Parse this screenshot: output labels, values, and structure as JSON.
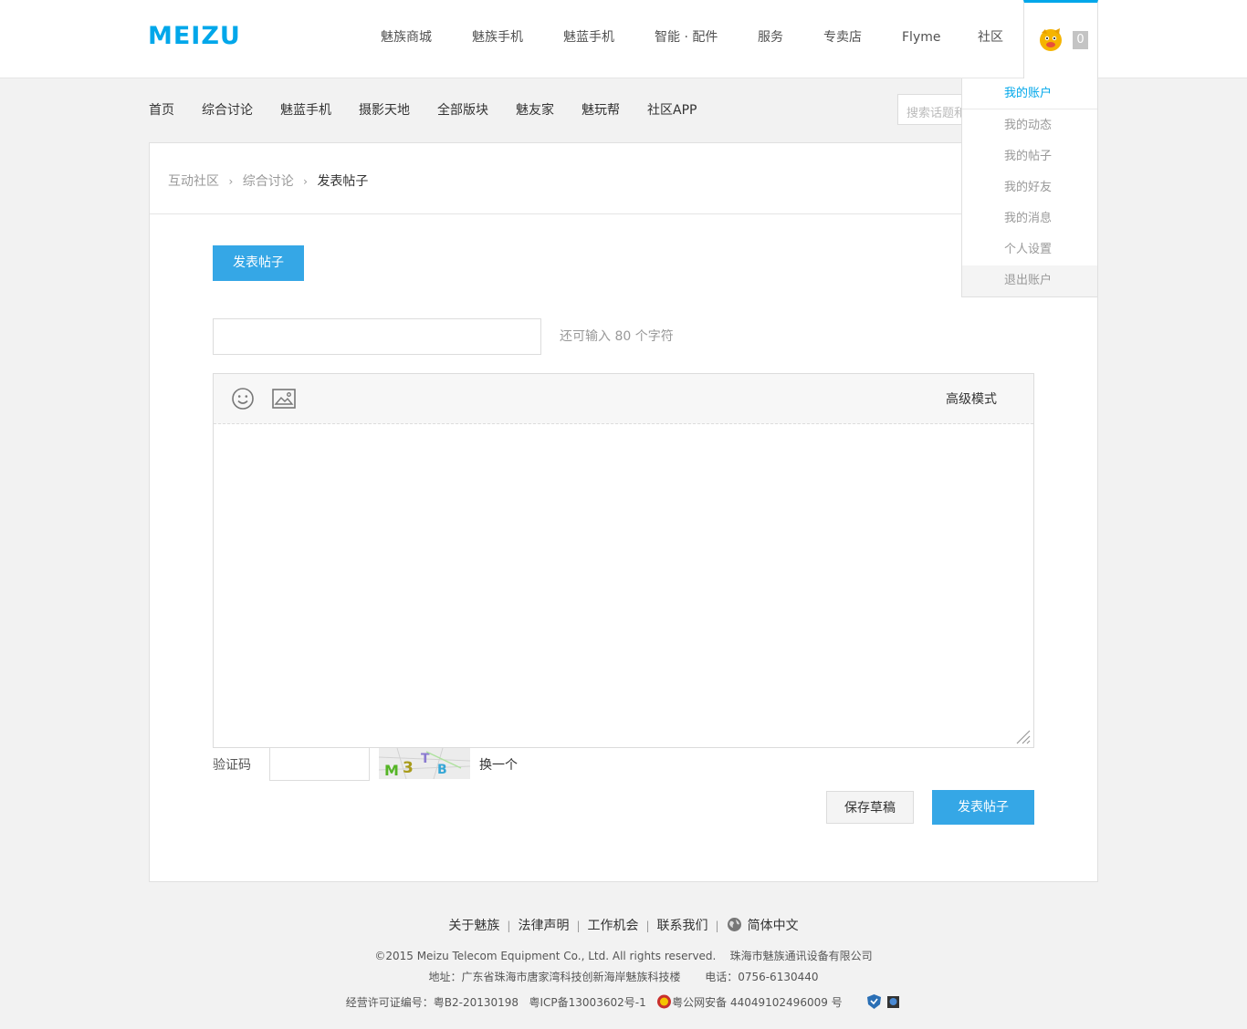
{
  "header": {
    "logo": "MEIZU",
    "nav": [
      "魅族商城",
      "魅族手机",
      "魅蓝手机",
      "智能 · 配件",
      "服务",
      "专卖店",
      "Flyme",
      "社区"
    ],
    "message_count": "0"
  },
  "user_menu": {
    "items": [
      "我的账户",
      "我的动态",
      "我的帖子",
      "我的好友",
      "我的消息",
      "个人设置",
      "退出账户"
    ]
  },
  "subnav": {
    "items": [
      "首页",
      "综合讨论",
      "魅蓝手机",
      "摄影天地",
      "全部版块",
      "魅友家",
      "魅玩帮",
      "社区APP"
    ],
    "search_placeholder": "搜索话题和"
  },
  "breadcrumb": {
    "items": [
      "互动社区",
      "综合讨论",
      "发表帖子"
    ],
    "separator": "›"
  },
  "form": {
    "tab_label": "发表帖子",
    "title_value": "",
    "char_hint": "还可输入 80 个字符",
    "advanced_mode": "高级模式",
    "captcha_label": "验证码",
    "captcha_text": "M3TB",
    "captcha_refresh": "换一个",
    "save_draft": "保存草稿",
    "submit": "发表帖子"
  },
  "footer": {
    "links": [
      "关于魅族",
      "法律声明",
      "工作机会",
      "联系我们"
    ],
    "language": "简体中文",
    "copyright": "©2015 Meizu Telecom Equipment Co., Ltd. All rights reserved.",
    "company": "珠海市魅族通讯设备有限公司",
    "address": "地址：广东省珠海市唐家湾科技创新海岸魅族科技楼",
    "phone": "电话：0756-6130440",
    "license": "经营许可证编号：粤B2-20130198",
    "icp": "粤ICP备13003602号-1",
    "police": "粤公网安备 44049102496009 号"
  },
  "colors": {
    "brand": "#00a7ea",
    "button": "#35a7e6"
  }
}
